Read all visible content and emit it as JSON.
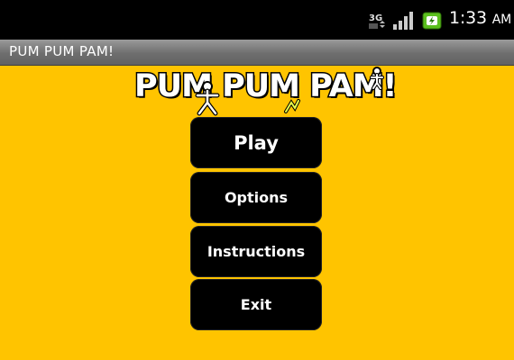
{
  "status_bar": {
    "network_badge": "3G",
    "time": "1:33",
    "ampm": "AM",
    "icons": [
      "3g-data-icon",
      "signal-strength-icon",
      "battery-charging-icon"
    ]
  },
  "app": {
    "title": "PUM PUM PAM!"
  },
  "logo": {
    "text": "PUM PUM PAM!"
  },
  "menu": {
    "play": "Play",
    "options": "Options",
    "instructions": "Instructions",
    "exit": "Exit"
  },
  "colors": {
    "background": "#ffc400",
    "button": "#000000",
    "button_text": "#ffffff",
    "title_bar": "#6e6e6e",
    "status_bar": "#000000",
    "battery": "#5bbf1e"
  }
}
